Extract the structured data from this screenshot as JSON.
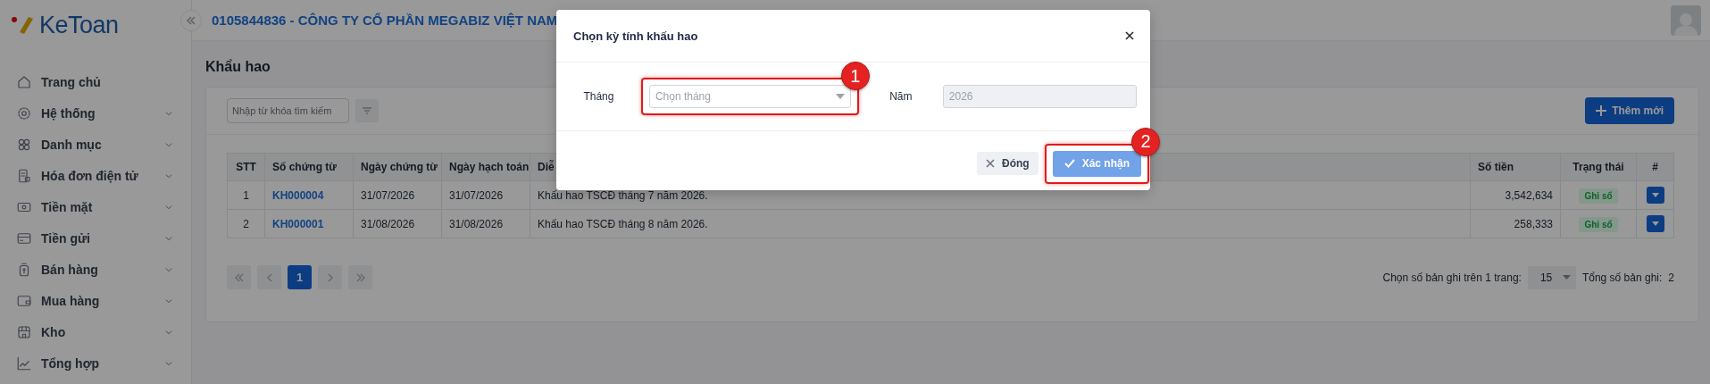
{
  "app": {
    "brand": "KeToan",
    "company": "0105844836 - CÔNG TY CỔ PHẦN MEGABIZ VIỆT NAM"
  },
  "sidebar": {
    "items": [
      {
        "label": "Trang chủ",
        "kind": "link"
      },
      {
        "label": "Hệ thống",
        "kind": "group"
      },
      {
        "label": "Danh mục",
        "kind": "group"
      },
      {
        "label": "Hóa đơn điện tử",
        "kind": "group"
      },
      {
        "label": "Tiền mặt",
        "kind": "group"
      },
      {
        "label": "Tiền gửi",
        "kind": "group"
      },
      {
        "label": "Bán hàng",
        "kind": "group"
      },
      {
        "label": "Mua hàng",
        "kind": "group"
      },
      {
        "label": "Kho",
        "kind": "group"
      },
      {
        "label": "Tổng hợp",
        "kind": "group"
      }
    ]
  },
  "page": {
    "title": "Khẩu hao",
    "search": {
      "placeholder": "Nhập từ khóa tìm kiếm"
    },
    "add_button": "Thêm mới",
    "table": {
      "columns": [
        "STT",
        "Số chứng từ",
        "Ngày chứng từ",
        "Ngày hạch toán",
        "Diễ",
        "Số tiền",
        "Trạng thái",
        "#"
      ],
      "rows": [
        {
          "stt": "1",
          "voucher": "KH000004",
          "voucher_date": "31/07/2026",
          "posting_date": "31/07/2026",
          "description": "Khấu hao TSCĐ tháng 7 năm 2026.",
          "amount": "3,542,634",
          "status": "Ghi sổ"
        },
        {
          "stt": "2",
          "voucher": "KH000001",
          "voucher_date": "31/08/2026",
          "posting_date": "31/08/2026",
          "description": "Khấu hao TSCĐ tháng 8 năm 2026.",
          "amount": "258,333",
          "status": "Ghi sổ"
        }
      ]
    },
    "pagination": {
      "pages": [
        {
          "label": "1",
          "selected": true
        }
      ],
      "page_size_label": "Chọn số bản ghi trên 1 trang:",
      "page_size": "15",
      "total_label": "Tổng số bản ghi:",
      "total": "2"
    }
  },
  "modal": {
    "title": "Chọn kỳ tính khấu hao",
    "fields": [
      {
        "label": "Tháng",
        "kind": "select",
        "placeholder": "Chọn tháng",
        "step": "1"
      },
      {
        "label": "Năm",
        "kind": "input",
        "value": "2026",
        "disabled": true
      }
    ],
    "buttons": [
      {
        "label": "Đóng",
        "kind": "secondary",
        "disabled": false
      },
      {
        "label": "Xác nhận",
        "kind": "primary",
        "disabled": true,
        "step": "2"
      }
    ]
  }
}
